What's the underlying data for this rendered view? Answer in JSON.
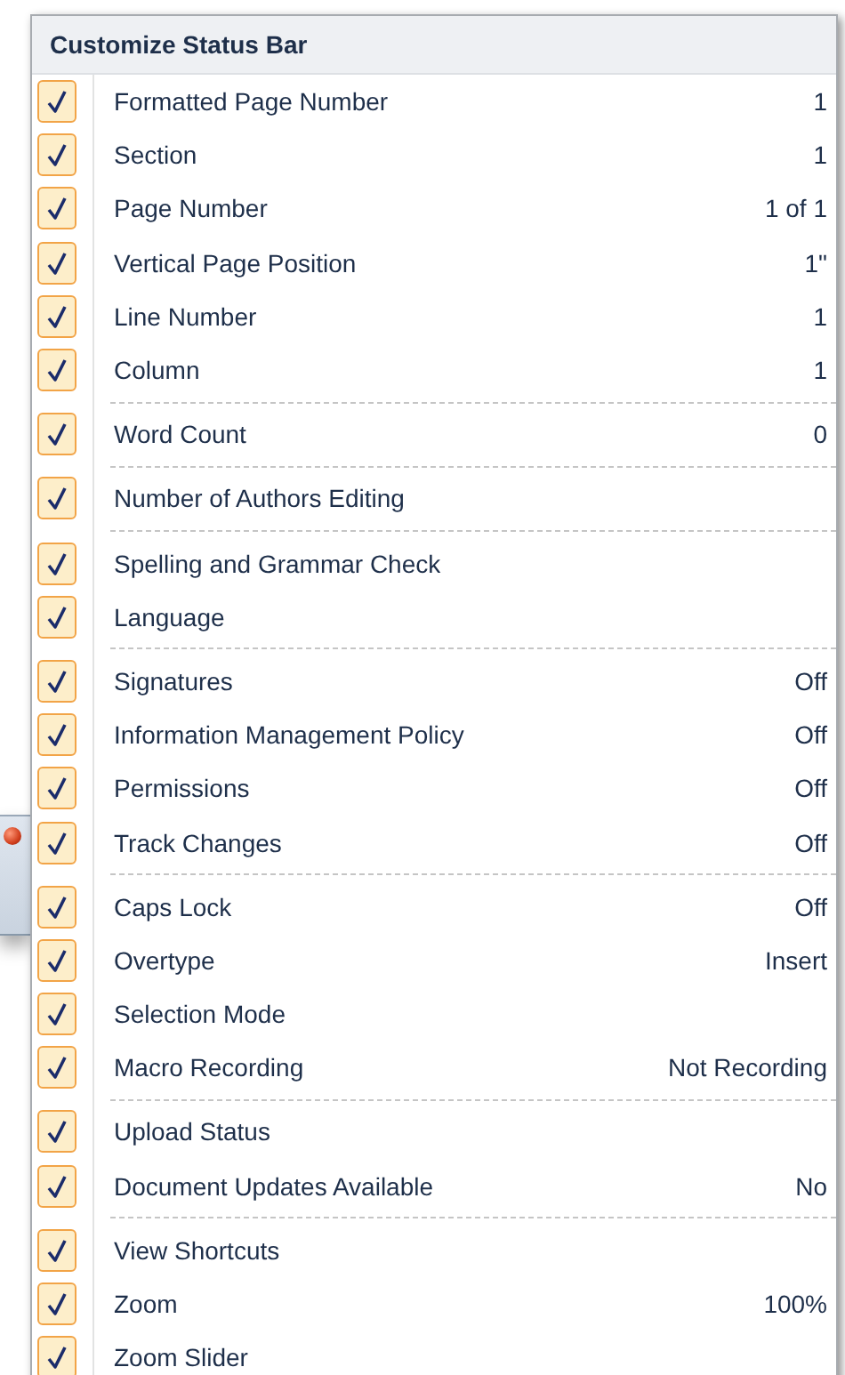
{
  "menu": {
    "title": "Customize Status Bar",
    "groups": [
      {
        "items": [
          {
            "label": "Formatted Page Number",
            "value": "1",
            "checked": true
          },
          {
            "label": "Section",
            "value": "1",
            "checked": true
          },
          {
            "label": "Page Number",
            "value": "1 of 1",
            "checked": true
          },
          {
            "label": "Vertical Page Position",
            "value": "1\"",
            "checked": true
          },
          {
            "label": "Line Number",
            "value": "1",
            "checked": true
          },
          {
            "label": "Column",
            "value": "1",
            "checked": true
          }
        ]
      },
      {
        "items": [
          {
            "label": "Word Count",
            "value": "0",
            "checked": true
          }
        ]
      },
      {
        "items": [
          {
            "label": "Number of Authors Editing",
            "checked": true
          }
        ]
      },
      {
        "items": [
          {
            "label": "Spelling and Grammar Check",
            "checked": true
          },
          {
            "label": "Language",
            "checked": true
          }
        ]
      },
      {
        "items": [
          {
            "label": "Signatures",
            "value": "Off",
            "checked": true
          },
          {
            "label": "Information Management Policy",
            "value": "Off",
            "checked": true
          },
          {
            "label": "Permissions",
            "value": "Off",
            "checked": true
          },
          {
            "label": "Track Changes",
            "value": "Off",
            "checked": true
          }
        ]
      },
      {
        "items": [
          {
            "label": "Caps Lock",
            "value": "Off",
            "checked": true
          },
          {
            "label": "Overtype",
            "value": "Insert",
            "checked": true
          },
          {
            "label": "Selection Mode",
            "checked": true
          },
          {
            "label": "Macro Recording",
            "value": "Not Recording",
            "checked": true
          }
        ]
      },
      {
        "items": [
          {
            "label": "Upload Status",
            "checked": true
          },
          {
            "label": "Document Updates Available",
            "value": "No",
            "checked": true
          }
        ]
      },
      {
        "items": [
          {
            "label": "View Shortcuts",
            "checked": true
          },
          {
            "label": "Zoom",
            "value": "100%",
            "checked": true
          },
          {
            "label": "Zoom Slider",
            "checked": true
          }
        ]
      }
    ]
  }
}
